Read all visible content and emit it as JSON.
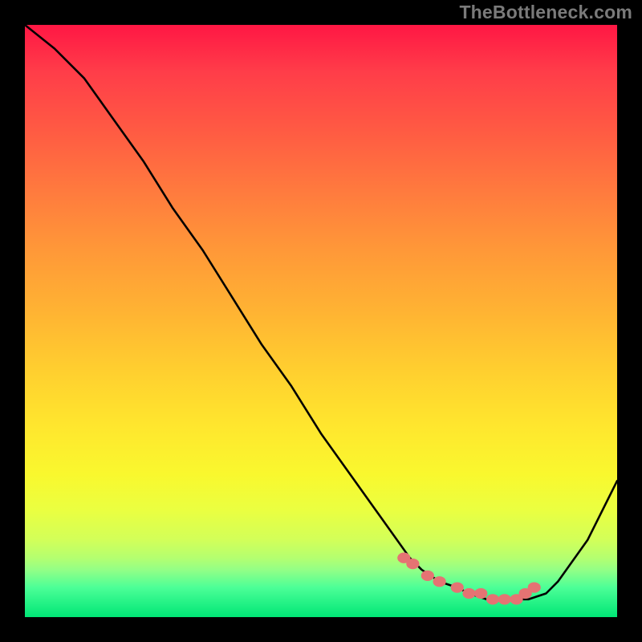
{
  "watermark": "TheBottleneck.com",
  "chart_data": {
    "type": "line",
    "title": "",
    "xlabel": "",
    "ylabel": "",
    "xlim": [
      0,
      100
    ],
    "ylim": [
      0,
      100
    ],
    "x": [
      0,
      5,
      10,
      15,
      20,
      25,
      30,
      35,
      40,
      45,
      50,
      55,
      60,
      65,
      67,
      70,
      73,
      75,
      78,
      80,
      82,
      85,
      88,
      90,
      95,
      100
    ],
    "values": [
      100,
      96,
      91,
      84,
      77,
      69,
      62,
      54,
      46,
      39,
      31,
      24,
      17,
      10,
      8,
      6,
      5,
      4,
      3,
      3,
      3,
      3,
      4,
      6,
      13,
      23
    ],
    "markers": {
      "x": [
        64,
        65.5,
        68,
        70,
        73,
        75,
        77,
        79,
        81,
        83,
        84.5,
        86
      ],
      "y": [
        10,
        9,
        7,
        6,
        5,
        4,
        4,
        3,
        3,
        3,
        4,
        5
      ]
    },
    "marker_color": "#e57373",
    "curve_color": "#000000"
  }
}
